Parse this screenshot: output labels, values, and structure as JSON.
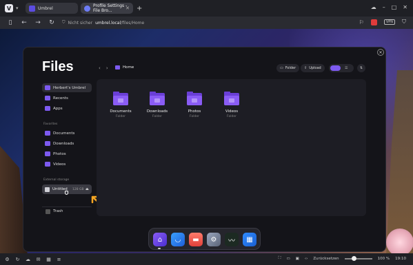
{
  "browser": {
    "tabs": [
      {
        "label": "Umbrel"
      },
      {
        "label": "Profile Settings - File Bro..."
      }
    ],
    "url_security": "Nicht sicher",
    "url_host": "umbrel.local",
    "url_path": "/files/Home",
    "vpn_label": "VPN"
  },
  "files": {
    "title": "Files",
    "breadcrumb": "Home",
    "toolbar": {
      "folder_label": "Folder",
      "upload_label": "Upload"
    },
    "view": "grid"
  },
  "sidebar": {
    "user_item": "Herbert's Umbrel",
    "top_items": [
      "Recents",
      "Apps"
    ],
    "favorites_label": "Favorites",
    "favorites": [
      "Documents",
      "Downloads",
      "Photos",
      "Videos"
    ],
    "external_label": "External storage",
    "storage": {
      "name": "Untitled",
      "size": "128 GB"
    },
    "trash_label": "Trash"
  },
  "folders": [
    {
      "name": "Documents",
      "type": "Folder"
    },
    {
      "name": "Downloads",
      "type": "Folder"
    },
    {
      "name": "Photos",
      "type": "Folder"
    },
    {
      "name": "Videos",
      "type": "Folder"
    }
  ],
  "dock": {
    "apps": [
      "home",
      "files",
      "app-store",
      "settings",
      "live-usage",
      "widgets"
    ]
  },
  "statusbar": {
    "reset_label": "Zurücksetzen",
    "zoom": "100 %",
    "zoom_level": 0.35,
    "clock": "19:10"
  },
  "colors": {
    "accent": "#7d5af0",
    "annotation_arrow": "#f5a623"
  }
}
